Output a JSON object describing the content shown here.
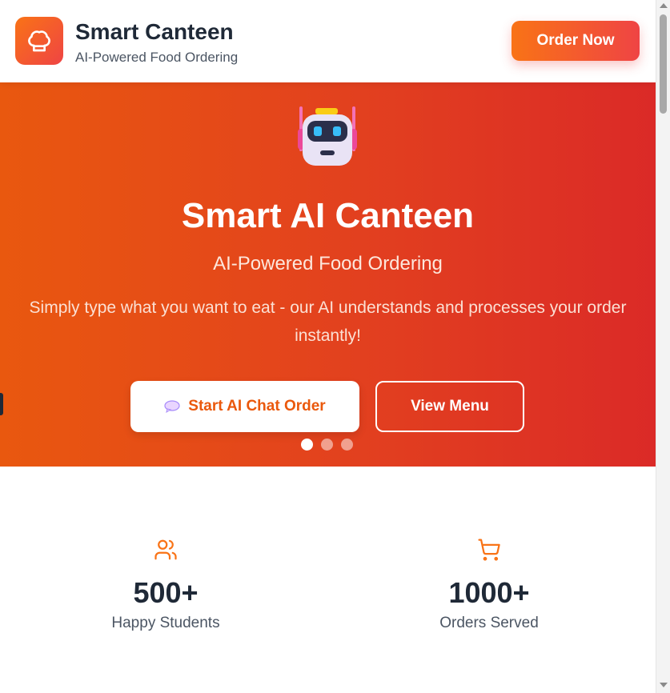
{
  "header": {
    "brand_title": "Smart Canteen",
    "brand_subtitle": "AI-Powered Food Ordering",
    "order_now_label": "Order Now",
    "logo_icon": "chef-hat-icon"
  },
  "hero": {
    "title": "Smart AI Canteen",
    "subtitle": "AI-Powered Food Ordering",
    "description": "Simply type what you want to eat - our AI understands and processes your order instantly!",
    "robot_icon": "robot-icon",
    "chat_button_label": "Start AI Chat Order",
    "chat_button_icon": "speech-bubble-icon",
    "menu_button_label": "View Menu",
    "carousel": {
      "total": 3,
      "active_index": 0
    }
  },
  "stats": [
    {
      "icon": "users-icon",
      "value": "500+",
      "label": "Happy Students"
    },
    {
      "icon": "shopping-cart-icon",
      "value": "1000+",
      "label": "Orders Served"
    }
  ],
  "colors": {
    "accent": "#f97316",
    "accent_red": "#ef4444",
    "hero_start": "#e9580f",
    "hero_end": "#db2a27",
    "text_dark": "#1f2937"
  }
}
